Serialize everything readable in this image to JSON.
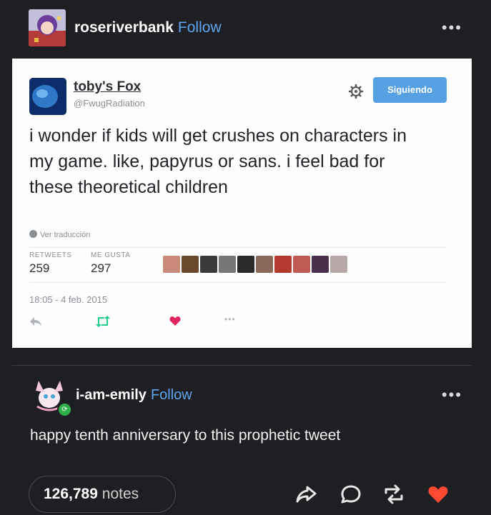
{
  "post": {
    "username": "roseriverbank",
    "follow_label": "Follow",
    "more": "•••"
  },
  "tweet": {
    "display_name": "toby's Fox",
    "handle": "@FwugRadiation",
    "following_label": "Siguiendo",
    "text": "i wonder if kids will get crushes on characters in my game. like, papyrus or sans. i feel bad for these theoretical children",
    "translate_label": "Ver traducción",
    "retweets_label": "RETWEETS",
    "retweets_value": "259",
    "likes_label": "ME GUSTA",
    "likes_value": "297",
    "date": "18:05 - 4 feb. 2015",
    "more": "•••",
    "liker_colors": [
      "#c98a7a",
      "#6a4b2c",
      "#3b3a3a",
      "#777777",
      "#2a2a2a",
      "#8a6a5a",
      "#b33a2c",
      "#c05a55",
      "#4a2f4a",
      "#b8a8a8"
    ]
  },
  "reblog": {
    "username": "i-am-emily",
    "follow_label": "Follow",
    "more": "•••",
    "text": "happy tenth anniversary to this prophetic tweet"
  },
  "footer": {
    "notes_count": "126,789",
    "notes_label": "notes"
  },
  "colors": {
    "background": "#1e1f22",
    "follow_link": "#5ea4f0",
    "siguiendo_button": "#56a0e3",
    "like_heart": "#ff4930"
  },
  "icons": [
    "gear-icon",
    "reply-icon",
    "retweet-icon",
    "like-icon",
    "share-icon",
    "comment-icon",
    "reblog-icon",
    "heart-icon"
  ]
}
